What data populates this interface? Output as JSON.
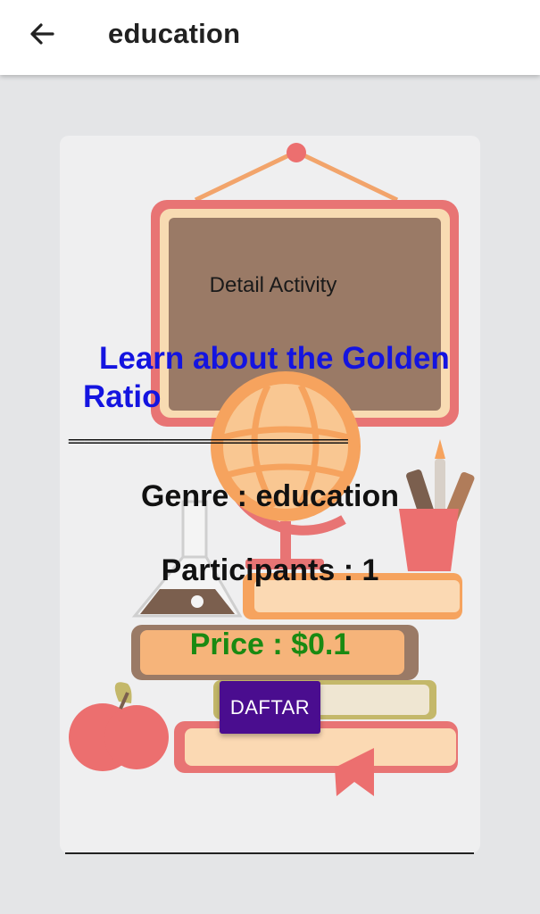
{
  "appbar": {
    "title": "education",
    "back_icon": "arrow-back-icon"
  },
  "card": {
    "header": "Detail Activity",
    "activity": "Learn about the Golden Ratio",
    "divider": "===================================",
    "genre": "Genre : education",
    "participants": "Participants : 1",
    "price": "Price : $0.1",
    "button": "DAFTAR"
  },
  "colors": {
    "title_blue": "#1414e0",
    "price_green": "#1a8a12",
    "button_purple": "#4a0d8f"
  }
}
